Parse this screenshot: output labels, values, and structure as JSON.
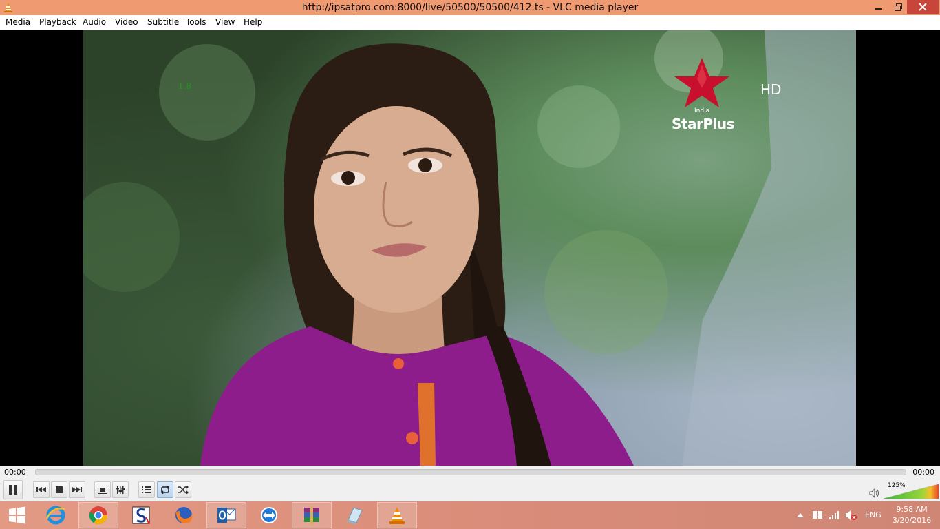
{
  "window": {
    "title": "http://ipsatpro.com:8000/live/50500/50500/412.ts - VLC media player"
  },
  "menu": [
    "Media",
    "Playback",
    "Audio",
    "Video",
    "Subtitle",
    "Tools",
    "View",
    "Help"
  ],
  "video": {
    "osd_number": "1.8",
    "channel_country": "India",
    "channel_name": "StarPlus",
    "hd_badge": "HD"
  },
  "playback": {
    "elapsed": "00:00",
    "total": "00:00",
    "progress": 0
  },
  "controls": {
    "buttons": [
      "pause-icon",
      "previous-icon",
      "stop-icon",
      "next-icon",
      "fullscreen-icon",
      "extended-settings-icon",
      "playlist-icon",
      "loop-icon",
      "random-icon"
    ],
    "volume_percent": "125%",
    "volume_level": 1.25
  },
  "taskbar": {
    "apps": [
      "start-icon",
      "internet-explorer-icon",
      "chrome-icon",
      "sync-app-icon",
      "firefox-icon",
      "outlook-icon",
      "teamviewer-icon",
      "winrar-icon",
      "notes-app-icon",
      "vlc-icon"
    ],
    "language": "ENG",
    "time": "9:58 AM",
    "date": "3/20/2016"
  },
  "colors": {
    "titlebar": "#f09a72",
    "close_button": "#c7453a",
    "taskbar": "#d88b78",
    "logo_red": "#c8102e"
  }
}
